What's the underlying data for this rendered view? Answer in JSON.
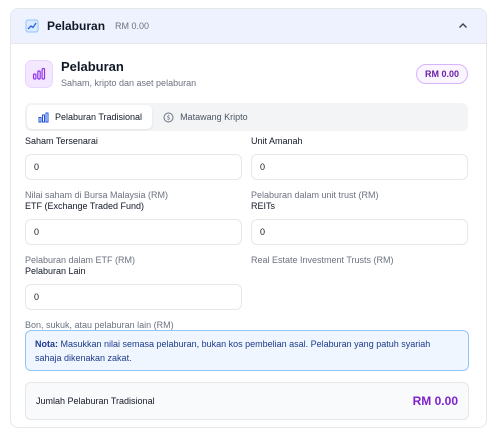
{
  "header": {
    "title": "Pelaburan",
    "amount": "RM 0.00",
    "icon": "chart-trend-icon",
    "collapse_icon": "chevron-up-icon"
  },
  "section": {
    "title": "Pelaburan",
    "subtitle": "Saham, kripto dan aset pelaburan",
    "badge": "RM 0.00",
    "icon": "bar-chart-icon"
  },
  "tabs": [
    {
      "label": "Pelaburan Tradisional",
      "icon": "bar-chart-icon",
      "active": true
    },
    {
      "label": "Matawang Kripto",
      "icon": "coin-icon",
      "active": false
    }
  ],
  "fields": {
    "saham": {
      "label": "Saham Tersenarai",
      "value": "0",
      "help": "Nilai saham di Bursa Malaysia (RM)"
    },
    "unit_amanah": {
      "label": "Unit Amanah",
      "value": "0",
      "help": "Pelaburan dalam unit trust (RM)"
    },
    "etf": {
      "label": "ETF (Exchange Traded Fund)",
      "value": "0",
      "help": "Pelaburan dalam ETF (RM)"
    },
    "reits": {
      "label": "REITs",
      "value": "0",
      "help": "Real Estate Investment Trusts (RM)"
    },
    "lain": {
      "label": "Pelaburan Lain",
      "value": "0",
      "help": "Bon, sukuk, atau pelaburan lain (RM)"
    }
  },
  "note": {
    "prefix": "Nota:",
    "text": " Masukkan nilai semasa pelaburan, bukan kos pembelian asal. Pelaburan yang patuh syariah sahaja dikenakan zakat."
  },
  "total": {
    "label": "Jumlah Pelaburan Tradisional",
    "value": "RM 0.00"
  },
  "colors": {
    "accent": "#7e22ce",
    "header_bg": "#eef2ff",
    "note_bg": "#eff6ff",
    "note_border": "#93c5fd"
  }
}
